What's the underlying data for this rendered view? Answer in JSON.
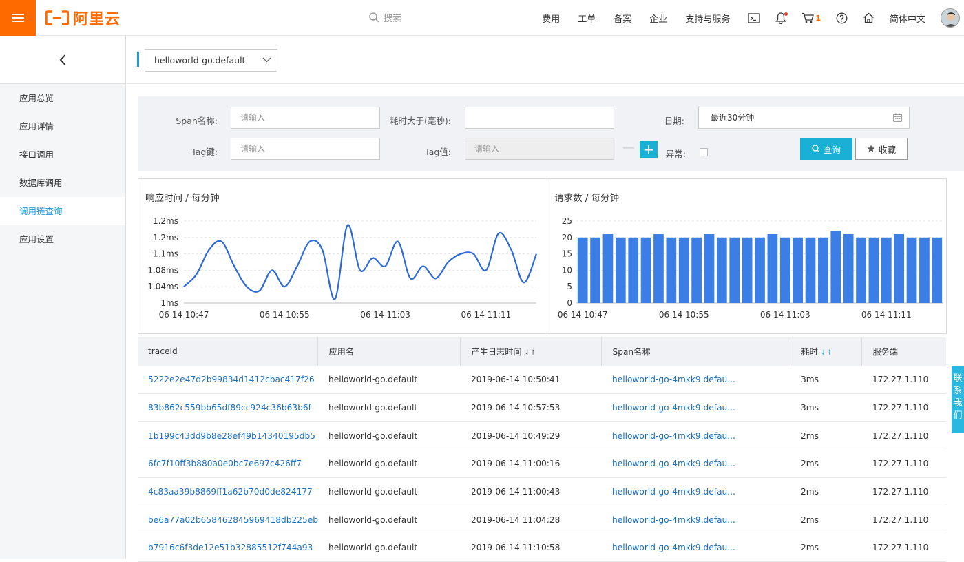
{
  "brand": {
    "logo_text": "阿里云",
    "accent": "#ff6a00"
  },
  "topbar": {
    "search_placeholder": "搜索",
    "nav": [
      "费用",
      "工单",
      "备案",
      "企业",
      "支持与服务"
    ],
    "cart_count": "1",
    "language": "简体中文",
    "icons": [
      "terminal-icon",
      "bell-icon",
      "cart-icon",
      "help-icon",
      "home-icon"
    ]
  },
  "sidebar": {
    "back_icon": "chevron-left-icon",
    "items": [
      {
        "label": "应用总览"
      },
      {
        "label": "应用详情"
      },
      {
        "label": "接口调用"
      },
      {
        "label": "数据库调用"
      },
      {
        "label": "调用链查询",
        "active": true
      },
      {
        "label": "应用设置"
      }
    ]
  },
  "app_selector": {
    "value": "helloworld-go.default"
  },
  "filter": {
    "span_label": "Span名称:",
    "span_placeholder": "请输入",
    "duration_label": "耗时大于(毫秒):",
    "duration_value": "",
    "date_label": "日期:",
    "date_value": "最近30分钟",
    "tag_key_label": "Tag键:",
    "tag_key_placeholder": "请输入",
    "tag_value_label": "Tag值:",
    "tag_value_placeholder": "请输入",
    "exception_label": "异常:",
    "query_button": "查询",
    "fav_button": "收藏"
  },
  "chart_data": [
    {
      "type": "line",
      "title": "响应时间 / 每分钟",
      "y_tick_labels": [
        "1ms",
        "1.04ms",
        "1.08ms",
        "1.1ms",
        "1.2ms",
        "1.2ms"
      ],
      "ylim": [
        1.0,
        1.2
      ],
      "x_tick_labels": [
        "06 14 10:47",
        "06 14 10:55",
        "06 14 11:03",
        "06 14 11:11"
      ],
      "x": [
        "10:47",
        "10:48",
        "10:49",
        "10:50",
        "10:51",
        "10:52",
        "10:53",
        "10:54",
        "10:55",
        "10:56",
        "10:57",
        "10:58",
        "10:59",
        "11:00",
        "11:01",
        "11:02",
        "11:03",
        "11:04",
        "11:05",
        "11:06",
        "11:07",
        "11:08",
        "11:09",
        "11:10",
        "11:11",
        "11:12",
        "11:13",
        "11:14",
        "11:15"
      ],
      "values": [
        1.04,
        1.07,
        1.13,
        1.15,
        1.09,
        1.04,
        1.03,
        1.08,
        1.04,
        1.09,
        1.15,
        1.13,
        1.01,
        1.19,
        1.08,
        1.11,
        1.09,
        1.15,
        1.06,
        1.09,
        1.06,
        1.1,
        1.12,
        1.12,
        1.08,
        1.17,
        1.13,
        1.05,
        1.12
      ],
      "grid": true,
      "color": "#2d6ad6"
    },
    {
      "type": "bar",
      "title": "请求数 / 每分钟",
      "y_tick_labels": [
        "0",
        "5",
        "10",
        "15",
        "20",
        "25"
      ],
      "ylim": [
        0,
        25
      ],
      "x_tick_labels": [
        "06 14 10:47",
        "06 14 10:55",
        "06 14 11:03",
        "06 14 11:11"
      ],
      "categories": [
        "10:47",
        "10:48",
        "10:49",
        "10:50",
        "10:51",
        "10:52",
        "10:53",
        "10:54",
        "10:55",
        "10:56",
        "10:57",
        "10:58",
        "10:59",
        "11:00",
        "11:01",
        "11:02",
        "11:03",
        "11:04",
        "11:05",
        "11:06",
        "11:07",
        "11:08",
        "11:09",
        "11:10",
        "11:11",
        "11:12",
        "11:13",
        "11:14",
        "11:15"
      ],
      "values": [
        20,
        20,
        21,
        20,
        20,
        20,
        21,
        20,
        20,
        20,
        21,
        20,
        20,
        20,
        20,
        21,
        20,
        20,
        20,
        20,
        22,
        21,
        20,
        20,
        20,
        21,
        20,
        20,
        20
      ],
      "grid": true,
      "color": "#3a7ee6"
    }
  ],
  "table": {
    "columns": [
      {
        "label": "traceId"
      },
      {
        "label": "应用名"
      },
      {
        "label": "产生日志时间",
        "sort": "⇃↾"
      },
      {
        "label": "Span名称"
      },
      {
        "label": "耗时",
        "sort": "⇃↾"
      },
      {
        "label": "服务端"
      }
    ],
    "rows": [
      [
        "5222e2e47d2b99834d1412cbac417f26",
        "helloworld-go.default",
        "2019-06-14 10:50:41",
        "helloworld-go-4mkk9.defau...",
        "3ms",
        "172.27.1.110"
      ],
      [
        "83b862c559bb65df89cc924c36b63b6f",
        "helloworld-go.default",
        "2019-06-14 10:57:53",
        "helloworld-go-4mkk9.defau...",
        "3ms",
        "172.27.1.110"
      ],
      [
        "1b199c43dd9b8e28ef49b14340195db5",
        "helloworld-go.default",
        "2019-06-14 10:49:29",
        "helloworld-go-4mkk9.defau...",
        "2ms",
        "172.27.1.110"
      ],
      [
        "6fc7f10ff3b880a0e0bc7e697c426ff7",
        "helloworld-go.default",
        "2019-06-14 11:00:16",
        "helloworld-go-4mkk9.defau...",
        "2ms",
        "172.27.1.110"
      ],
      [
        "4c83aa39b8869ff1a62b70d0de824177",
        "helloworld-go.default",
        "2019-06-14 11:00:43",
        "helloworld-go-4mkk9.defau...",
        "2ms",
        "172.27.1.110"
      ],
      [
        "be6a77a02b658462845969418db225eb",
        "helloworld-go.default",
        "2019-06-14 11:04:28",
        "helloworld-go-4mkk9.defau...",
        "2ms",
        "172.27.1.110"
      ],
      [
        "b7916c6f3de12e51b32885512f744a93",
        "helloworld-go.default",
        "2019-06-14 11:10:58",
        "helloworld-go-4mkk9.defau...",
        "2ms",
        "172.27.1.110"
      ]
    ]
  },
  "contact_tab": "联系我们"
}
